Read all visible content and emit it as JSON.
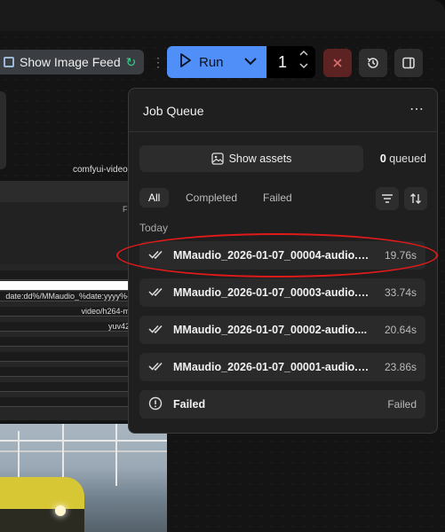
{
  "toolbar": {
    "image_feed_label": "Show Image Feed",
    "run_label": "Run",
    "run_count": "1"
  },
  "canvas": {
    "node_title": "comfyui-videoh",
    "node_field_hint": "F",
    "rows": [
      "date:dd%/MMaudio_%date:yyyy%-",
      "video/h264-m",
      "yuv42"
    ]
  },
  "queue": {
    "title": "Job Queue",
    "more_icon": "more-horizontal-icon",
    "show_assets_label": "Show assets",
    "queued_count": "0",
    "queued_label": "queued",
    "tabs": [
      {
        "label": "All",
        "active": true
      },
      {
        "label": "Completed",
        "active": false
      },
      {
        "label": "Failed",
        "active": false
      }
    ],
    "group_label": "Today",
    "jobs": [
      {
        "name": "MMaudio_2026-01-07_00004-audio.m...",
        "time": "19.76s",
        "status": "completed"
      },
      {
        "name": "MMaudio_2026-01-07_00003-audio.m...",
        "time": "33.74s",
        "status": "completed"
      },
      {
        "name": "MMaudio_2026-01-07_00002-audio....",
        "time": "20.64s",
        "status": "completed"
      },
      {
        "name": "MMaudio_2026-01-07_00001-audio.m...",
        "time": "23.86s",
        "status": "completed"
      },
      {
        "name": "Failed",
        "time": "Failed",
        "status": "failed"
      }
    ]
  },
  "colors": {
    "run_blue": "#4f8ff7",
    "cancel_red": "#5c2322",
    "highlight_red": "#e01a1a",
    "panel_bg": "#1f1f1f"
  }
}
